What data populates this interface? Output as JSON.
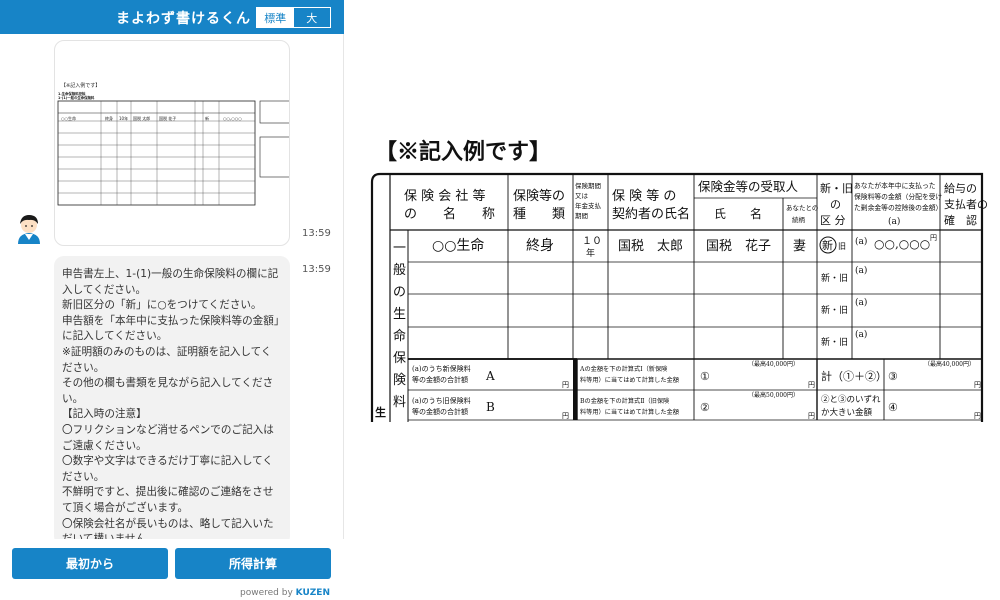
{
  "header": {
    "title": "まよわず書けるくん",
    "size_standard": "標準",
    "size_large": "大"
  },
  "chat": {
    "preview_caption": "【※記入例です】",
    "preview_sub1": "1.生命保険料控除",
    "preview_sub2": "1-(1)一般の生命保険料",
    "preview_cells": {
      "company": "○○生命",
      "type": "終身",
      "period": "10年",
      "contractor": "国税 太郎",
      "receiver": "国税 花子",
      "marker": "新",
      "amount": "○○,○○○"
    },
    "image_time": "13:59",
    "text_time": "13:59",
    "message_lines": [
      "申告書左上、1-(1)一般の生命保険料の欄に記入してください。",
      "新旧区分の「新」に○をつけてください。",
      "申告額を「本年中に支払った保険料等の金額」に記入してください。",
      "※証明額のみのものは、証明額を記入してください。",
      "その他の欄も書類を見ながら記入してください。",
      "【記入時の注意】",
      "〇フリクションなど消せるペンでのご記入はご遠慮ください。",
      "〇数字や文字はできるだけ丁寧に記入してください。",
      "不鮮明ですと、提出後に確認のご連絡をさせて頂く場合がございます。",
      "〇保険会社名が長いものは、略して記入いただいて構いません。"
    ]
  },
  "footer": {
    "start_label": "最初から",
    "calc_label": "所得計算",
    "powered_prefix": "powered by",
    "powered_brand": "KUZEN"
  },
  "document": {
    "title": "【※記入例です】",
    "headers": {
      "company": "保険会社等の名称",
      "company_l1": "保 険 会 社 等",
      "company_l2": "の　　名　　称",
      "type_l1": "保険等の",
      "type_l2": "種　　類",
      "period": "保険期間又は年金支払期間",
      "contractor_l1": "保 険 等 の",
      "contractor_l2": "契約者の氏名",
      "receiver": "保険金等の受取人",
      "receiver_name": "氏　　名",
      "relation": "あなたとの続柄",
      "newold_l1": "新・旧",
      "newold_l2": "の",
      "newold_l3": "区 分",
      "amount_l1": "あなたが本年中に支払った",
      "amount_l2": "保険料等の金額（分配を受け",
      "amount_l3": "た剰余金等の控除後の金額）",
      "amount_a": "(a)",
      "confirm_l1": "給与の",
      "confirm_l2": "支払者の",
      "confirm_l3": "確　認"
    },
    "side_label": "一般の生命保険料",
    "side_extra": "生",
    "row1": {
      "company": "○○生命",
      "type": "終身",
      "period_num": "１０",
      "period_unit": "年",
      "contractor": "国税　太郎",
      "receiver": "国税　花子",
      "relation": "妻",
      "new": "新",
      "old": "旧",
      "amount_prefix": "(a)",
      "amount": "○○,○○○",
      "yen": "円"
    },
    "blank_newold": "新・旧",
    "blank_amount": "(a)",
    "totals": {
      "new_total_l1": "(a)のうち新保険料",
      "new_total_l2": "等の金額の合計額",
      "old_total_l1": "(a)のうち旧保険料",
      "old_total_l2": "等の金額の合計額",
      "letter_a": "A",
      "letter_b": "B",
      "yen": "円",
      "calc1_l1": "Aの金額を下の計算式Ⅰ（新保険",
      "calc1_l2": "料等用）に当てはめて計算した金額",
      "calc2_l1": "Bの金額を下の計算式Ⅱ（旧保険",
      "calc2_l2": "料等用）に当てはめて計算した金額",
      "max1": "（最高40,000円）",
      "max2": "（最高50,000円）",
      "max3": "（最高40,000円）",
      "circle1": "①",
      "circle2": "②",
      "circle3": "③",
      "circle4": "④",
      "sum_label": "計（①＋②）",
      "larger_l1": "②と③のいずれ",
      "larger_l2": "か大きい金額"
    }
  }
}
